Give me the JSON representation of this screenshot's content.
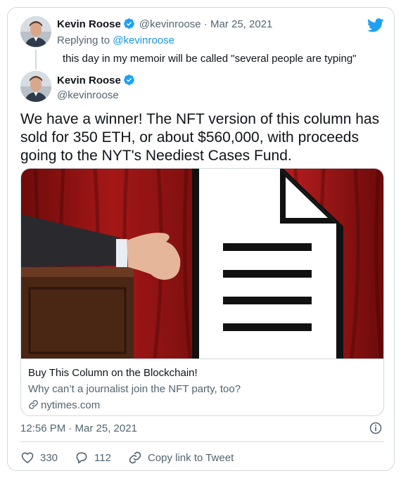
{
  "reply": {
    "author_name": "Kevin Roose",
    "handle": "@kevinroose",
    "separator": "·",
    "date": "Mar 25, 2021",
    "replying_to_label": "Replying to",
    "replying_to_handle": "@kevinroose",
    "text": "this day in my memoir will be called \"several people are typing\""
  },
  "tweet": {
    "author_name": "Kevin Roose",
    "handle": "@kevinroose",
    "text": "We have a winner! The NFT version of this column has sold for 350 ETH, or about $560,000, with proceeds going to the NYT's Neediest Cases Fund.",
    "link_card": {
      "title": "Buy This Column on the Blockchain!",
      "description": "Why can’t a journalist join the NFT party, too?",
      "domain": "nytimes.com"
    },
    "timestamp": "12:56 PM · Mar 25, 2021"
  },
  "actions": {
    "likes": "330",
    "replies": "112",
    "copy_link_label": "Copy link to Tweet"
  },
  "colors": {
    "accent": "#1da1f2",
    "muted": "#536471",
    "like_icon": "#536471",
    "curtain": "#8b1212"
  },
  "icons": {
    "brand": "twitter-bird-icon",
    "verified": "verified-badge-icon",
    "like": "heart-icon",
    "reply": "comment-icon",
    "copy_link": "link-icon",
    "info": "info-icon"
  }
}
